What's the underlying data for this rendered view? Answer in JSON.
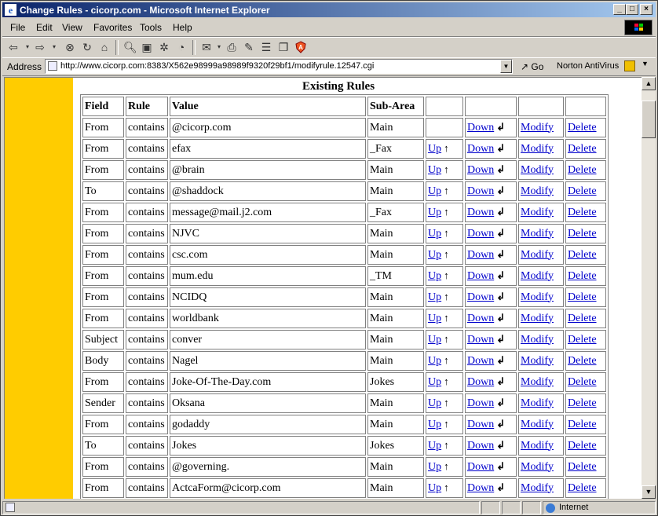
{
  "window": {
    "title": "Change Rules - cicorp.com - Microsoft Internet Explorer"
  },
  "menu": [
    "File",
    "Edit",
    "View",
    "Favorites",
    "Tools",
    "Help"
  ],
  "address": {
    "label": "Address",
    "url": "http://www.cicorp.com:8383/X562e98999a98989f9320f29bf1/modifyrule.12547.cgi",
    "go": "Go",
    "norton": "Norton AntiVirus"
  },
  "page": {
    "title": "Existing Rules",
    "headers": [
      "Field",
      "Rule",
      "Value",
      "Sub-Area"
    ],
    "links": {
      "up": "Up",
      "down": "Down",
      "modify": "Modify",
      "delete": "Delete"
    },
    "rows": [
      {
        "field": "From",
        "rule": "contains",
        "value": "@cicorp.com",
        "subarea": "Main",
        "up": false
      },
      {
        "field": "From",
        "rule": "contains",
        "value": "efax",
        "subarea": "_Fax",
        "up": true
      },
      {
        "field": "From",
        "rule": "contains",
        "value": "@brain",
        "subarea": "Main",
        "up": true
      },
      {
        "field": "To",
        "rule": "contains",
        "value": "@shaddock",
        "subarea": "Main",
        "up": true
      },
      {
        "field": "From",
        "rule": "contains",
        "value": "message@mail.j2.com",
        "subarea": "_Fax",
        "up": true
      },
      {
        "field": "From",
        "rule": "contains",
        "value": "NJVC",
        "subarea": "Main",
        "up": true
      },
      {
        "field": "From",
        "rule": "contains",
        "value": "csc.com",
        "subarea": "Main",
        "up": true
      },
      {
        "field": "From",
        "rule": "contains",
        "value": "mum.edu",
        "subarea": "_TM",
        "up": true
      },
      {
        "field": "From",
        "rule": "contains",
        "value": "NCIDQ",
        "subarea": "Main",
        "up": true
      },
      {
        "field": "From",
        "rule": "contains",
        "value": "worldbank",
        "subarea": "Main",
        "up": true
      },
      {
        "field": "Subject",
        "rule": "contains",
        "value": "conver",
        "subarea": "Main",
        "up": true
      },
      {
        "field": "Body",
        "rule": "contains",
        "value": "Nagel",
        "subarea": "Main",
        "up": true
      },
      {
        "field": "From",
        "rule": "contains",
        "value": "Joke-Of-The-Day.com",
        "subarea": "Jokes",
        "up": true
      },
      {
        "field": "Sender",
        "rule": "contains",
        "value": "Oksana",
        "subarea": "Main",
        "up": true
      },
      {
        "field": "From",
        "rule": "contains",
        "value": "godaddy",
        "subarea": "Main",
        "up": true
      },
      {
        "field": "To",
        "rule": "contains",
        "value": "Jokes",
        "subarea": "Jokes",
        "up": true
      },
      {
        "field": "From",
        "rule": "contains",
        "value": "@governing.",
        "subarea": "Main",
        "up": true
      },
      {
        "field": "From",
        "rule": "contains",
        "value": "ActcaForm@cicorp.com",
        "subarea": "Main",
        "up": true
      }
    ]
  },
  "status": {
    "zone": "Internet"
  },
  "colors": {
    "sidebar": "#ffcc00",
    "link": "#0000cc",
    "titlebar": "#0a246a"
  }
}
